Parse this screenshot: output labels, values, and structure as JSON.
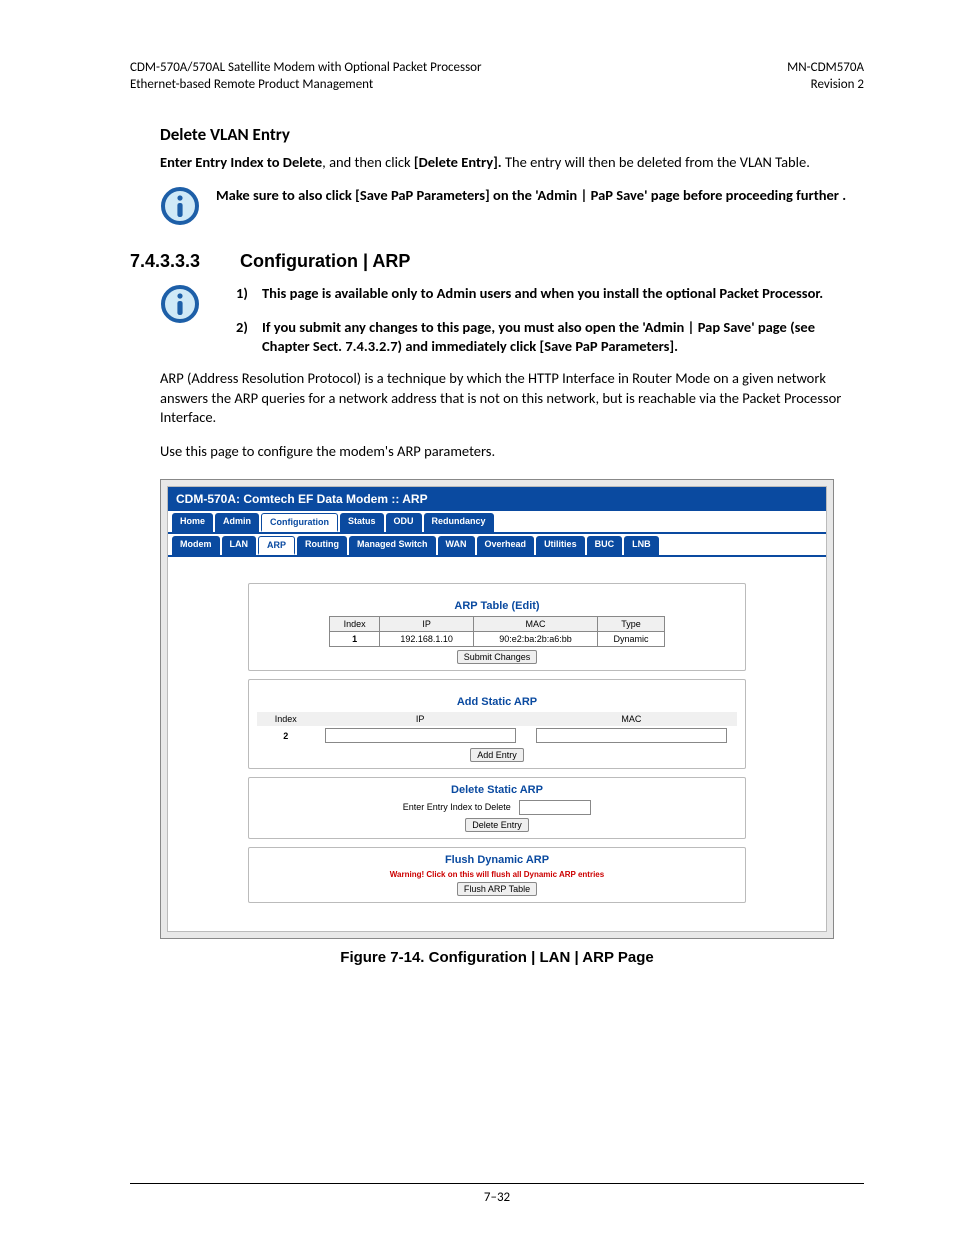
{
  "header": {
    "leftLine1": "CDM-570A/570AL Satellite Modem with Optional Packet Processor",
    "leftLine2": "Ethernet-based Remote Product Management",
    "rightLine1": "MN-CDM570A",
    "rightLine2": "Revision 2"
  },
  "section1": {
    "heading": "Delete VLAN Entry",
    "para_lead_bold": "Enter Entry Index to Delete",
    "para_mid": ", and then click ",
    "para_bold2": "[Delete Entry].",
    "para_tail": " The entry will then be deleted from the VLAN Table.",
    "alert": "Make sure to also click [Save PaP Parameters] on the 'Admin | PaP Save' page before proceeding further ."
  },
  "section2": {
    "number": "7.4.3.3.3",
    "title": "Configuration | ARP",
    "note1_prefix": "1)",
    "note1": "This page is available only to Admin users and when you install the optional Packet Processor.",
    "note2_prefix": "2)",
    "note2": "If you submit any changes to this page, you must also open the 'Admin | Pap Save' page (see Chapter Sect. 7.4.3.2.7) and immediately click [Save PaP Parameters].",
    "para1": "ARP (Address Resolution Protocol) is a technique by which the HTTP Interface in Router Mode on a given network answers the ARP queries for a network address that is not on this network, but is reachable via the Packet Processor Interface.",
    "para2": "Use this page to configure the modem's ARP parameters."
  },
  "shot": {
    "title": "CDM-570A: Comtech EF Data Modem :: ARP",
    "tabs1": [
      "Home",
      "Admin",
      "Configuration",
      "Status",
      "ODU",
      "Redundancy"
    ],
    "tabs1_selected": 2,
    "tabs2": [
      "Modem",
      "LAN",
      "ARP",
      "Routing",
      "Managed Switch",
      "WAN",
      "Overhead",
      "Utilities",
      "BUC",
      "LNB"
    ],
    "tabs2_selected": 2,
    "arp_edit_title": "ARP Table (Edit)",
    "arp_edit_headers": [
      "Index",
      "IP",
      "MAC",
      "Type"
    ],
    "arp_edit_row": [
      "1",
      "192.168.1.10",
      "90:e2:ba:2b:a6:bb",
      "Dynamic"
    ],
    "submit_btn": "Submit Changes",
    "add_title": "Add Static ARP",
    "add_headers": [
      "Index",
      "IP",
      "MAC"
    ],
    "add_index": "2",
    "add_btn": "Add Entry",
    "del_title": "Delete Static ARP",
    "del_label": "Enter Entry Index to Delete",
    "del_btn": "Delete Entry",
    "flush_title": "Flush Dynamic ARP",
    "flush_warn": "Warning! Click on this will flush all Dynamic ARP entries",
    "flush_btn": "Flush ARP Table"
  },
  "caption": "Figure 7-14. Configuration | LAN | ARP Page",
  "pageNum": "7–32"
}
